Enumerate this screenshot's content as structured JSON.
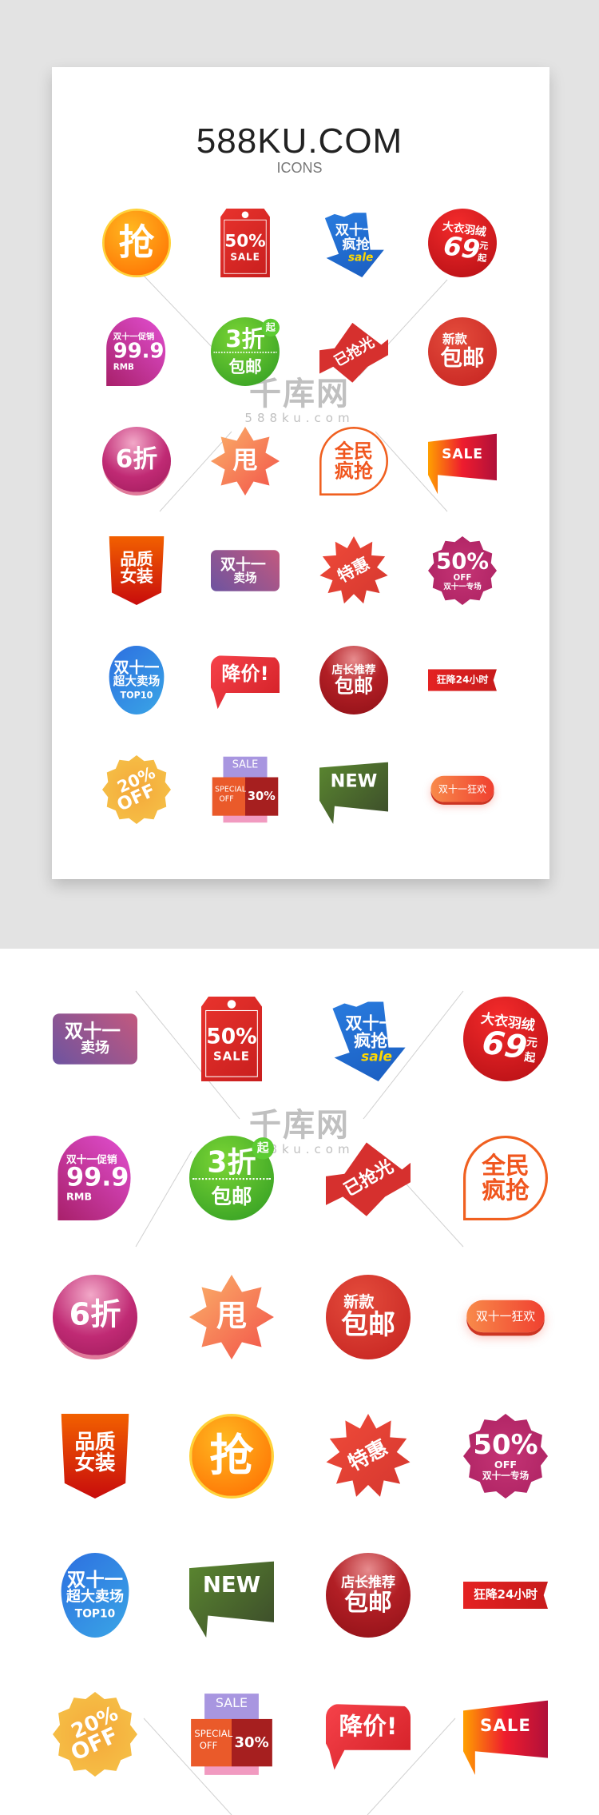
{
  "header": {
    "title": "588KU.COM",
    "subtitle": "ICONS"
  },
  "watermark": {
    "logo_text": "千库网",
    "domain": "588ku.com"
  },
  "badges": {
    "qiang": {
      "type": "qiang",
      "name": "grab-circle-badge",
      "lines": [
        "抢"
      ]
    },
    "tag50": {
      "type": "tag50",
      "name": "sale-50-tag-badge",
      "lines": [
        "50%",
        "SALE"
      ]
    },
    "arrow": {
      "type": "arrow",
      "name": "double11-rush-arrow-badge",
      "lines": [
        "双十一",
        "疯抢",
        "sale"
      ]
    },
    "coat": {
      "type": "coat",
      "name": "coat-69-badge",
      "lines": [
        "大衣羽绒",
        "69",
        "元",
        "起"
      ]
    },
    "promo": {
      "type": "promo",
      "name": "promo-99-badge",
      "lines": [
        "双十一促销",
        "99.9",
        "RMB"
      ]
    },
    "zhe3": {
      "type": "zhe3",
      "name": "discount-30-free-shipping-badge",
      "lines": [
        "3折",
        "起",
        "包邮"
      ]
    },
    "soldout": {
      "type": "soldout",
      "name": "sold-out-badge",
      "lines": [
        "已抢光"
      ]
    },
    "xinkuan": {
      "type": "xinkuan",
      "name": "new-free-shipping-badge",
      "lines": [
        "新款",
        "包邮"
      ]
    },
    "zhe6": {
      "type": "zhe6",
      "name": "discount-60-bubble-badge",
      "lines": [
        "6折"
      ]
    },
    "shuai": {
      "type": "shuai",
      "name": "clearance-flower-badge",
      "lines": [
        "甩"
      ]
    },
    "quanmin": {
      "type": "quanmin",
      "name": "everyone-rush-badge",
      "lines": [
        "全民",
        "疯抢"
      ]
    },
    "salerib": {
      "type": "salerib",
      "name": "sale-ribbon-badge",
      "lines": [
        "SALE"
      ]
    },
    "nvzhuang": {
      "type": "nvzhuang",
      "name": "quality-womenswear-badge",
      "lines": [
        "品质",
        "女装"
      ]
    },
    "maichang": {
      "type": "maichang",
      "name": "double11-store-badge",
      "lines": [
        "双十一",
        "卖场"
      ]
    },
    "tehui": {
      "type": "tehui",
      "name": "special-offer-burst-badge",
      "lines": [
        "特惠"
      ]
    },
    "off50": {
      "type": "off50",
      "name": "off-50-flower-badge",
      "lines": [
        "50%",
        "OFF",
        "双十一专场"
      ]
    },
    "top10": {
      "type": "top10",
      "name": "top10-store-badge",
      "lines": [
        "双十一",
        "超大卖场",
        "TOP10"
      ]
    },
    "jiangjia": {
      "type": "jiangjia",
      "name": "price-drop-bubble-badge",
      "lines": [
        "降价!"
      ]
    },
    "dianzhang": {
      "type": "dianzhang",
      "name": "manager-pick-badge",
      "lines": [
        "店长推荐",
        "包邮"
      ]
    },
    "kuangjiang": {
      "type": "kuangjiang",
      "name": "24h-drop-ribbon-badge",
      "lines": [
        "狂降24小时"
      ]
    },
    "off20": {
      "type": "off20",
      "name": "off-20-flower-badge",
      "lines": [
        "20%",
        "OFF"
      ]
    },
    "special": {
      "type": "special",
      "name": "special-off-30-badge",
      "lines": [
        "SALE",
        "SPECIAL",
        "OFF",
        "30%"
      ]
    },
    "new": {
      "type": "new",
      "name": "new-flag-badge",
      "lines": [
        "NEW"
      ]
    },
    "pill": {
      "type": "pill",
      "name": "double11-carnival-pill-badge",
      "lines": [
        "双十一狂欢"
      ]
    }
  },
  "top_grid": [
    [
      "qiang",
      "tag50",
      "arrow",
      "coat"
    ],
    [
      "promo",
      "zhe3",
      "soldout",
      "xinkuan"
    ],
    [
      "zhe6",
      "shuai",
      "quanmin",
      "salerib"
    ],
    [
      "nvzhuang",
      "maichang",
      "tehui",
      "off50"
    ],
    [
      "top10",
      "jiangjia",
      "dianzhang",
      "kuangjiang"
    ],
    [
      "off20",
      "special",
      "new",
      "pill"
    ]
  ],
  "bottom_grid": [
    [
      "maichang",
      "tag50",
      "arrow",
      "coat"
    ],
    [
      "promo",
      "zhe3",
      "soldout",
      "quanmin"
    ],
    [
      "zhe6",
      "shuai",
      "xinkuan",
      "pill"
    ],
    [
      "nvzhuang",
      "qiang",
      "tehui",
      "off50"
    ],
    [
      "top10",
      "new",
      "dianzhang",
      "kuangjiang"
    ],
    [
      "off20",
      "special",
      "jiangjia",
      "salerib"
    ]
  ]
}
